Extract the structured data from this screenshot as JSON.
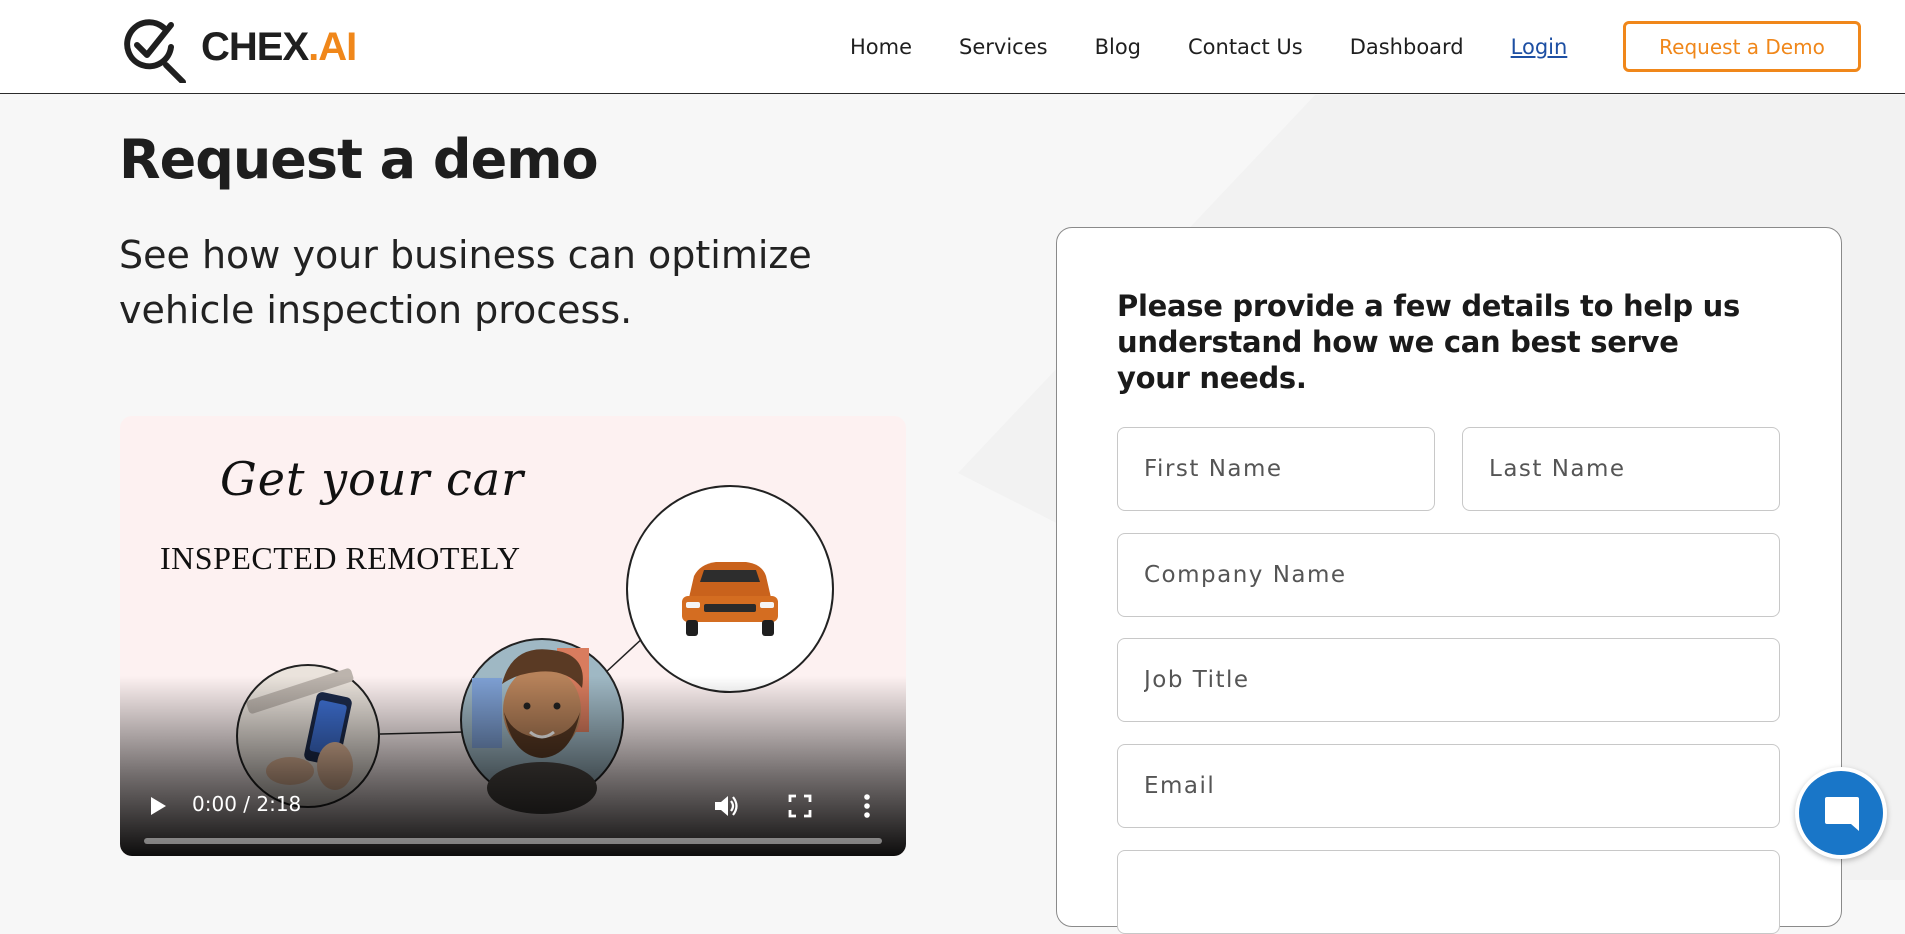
{
  "header": {
    "logo": {
      "brand": "CHEX",
      "accent": ".AI"
    },
    "nav": [
      {
        "label": "Home"
      },
      {
        "label": "Services"
      },
      {
        "label": "Blog"
      },
      {
        "label": "Contact Us"
      },
      {
        "label": "Dashboard"
      },
      {
        "label": "Login"
      }
    ],
    "cta_label": "Request a Demo"
  },
  "main": {
    "title": "Request a demo",
    "subtitle": "See how your business can optimize vehicle inspection process."
  },
  "video": {
    "headline_script": "Get your car",
    "headline_caps": "INSPECTED REMOTELY",
    "time_display": "0:00 / 2:18",
    "progress": 0
  },
  "form": {
    "heading": "Please provide a few details to help us understand how we can best serve your needs.",
    "fields": {
      "first_name": {
        "placeholder": "First Name"
      },
      "last_name": {
        "placeholder": "Last Name"
      },
      "company": {
        "placeholder": "Company Name"
      },
      "job_title": {
        "placeholder": "Job Title"
      },
      "email": {
        "placeholder": "Email"
      },
      "extra": {
        "placeholder": ""
      }
    }
  },
  "icons": {
    "logo": "magnifier-check-icon",
    "play": "play-icon",
    "volume": "volume-icon",
    "fullscreen": "fullscreen-icon",
    "more": "more-vertical-icon",
    "chat": "chat-icon"
  },
  "colors": {
    "accent": "#f0871a",
    "link": "#1d4fa3",
    "chat": "#1976c8",
    "text": "#1e1e1e",
    "page_bg": "#f7f7f7"
  }
}
